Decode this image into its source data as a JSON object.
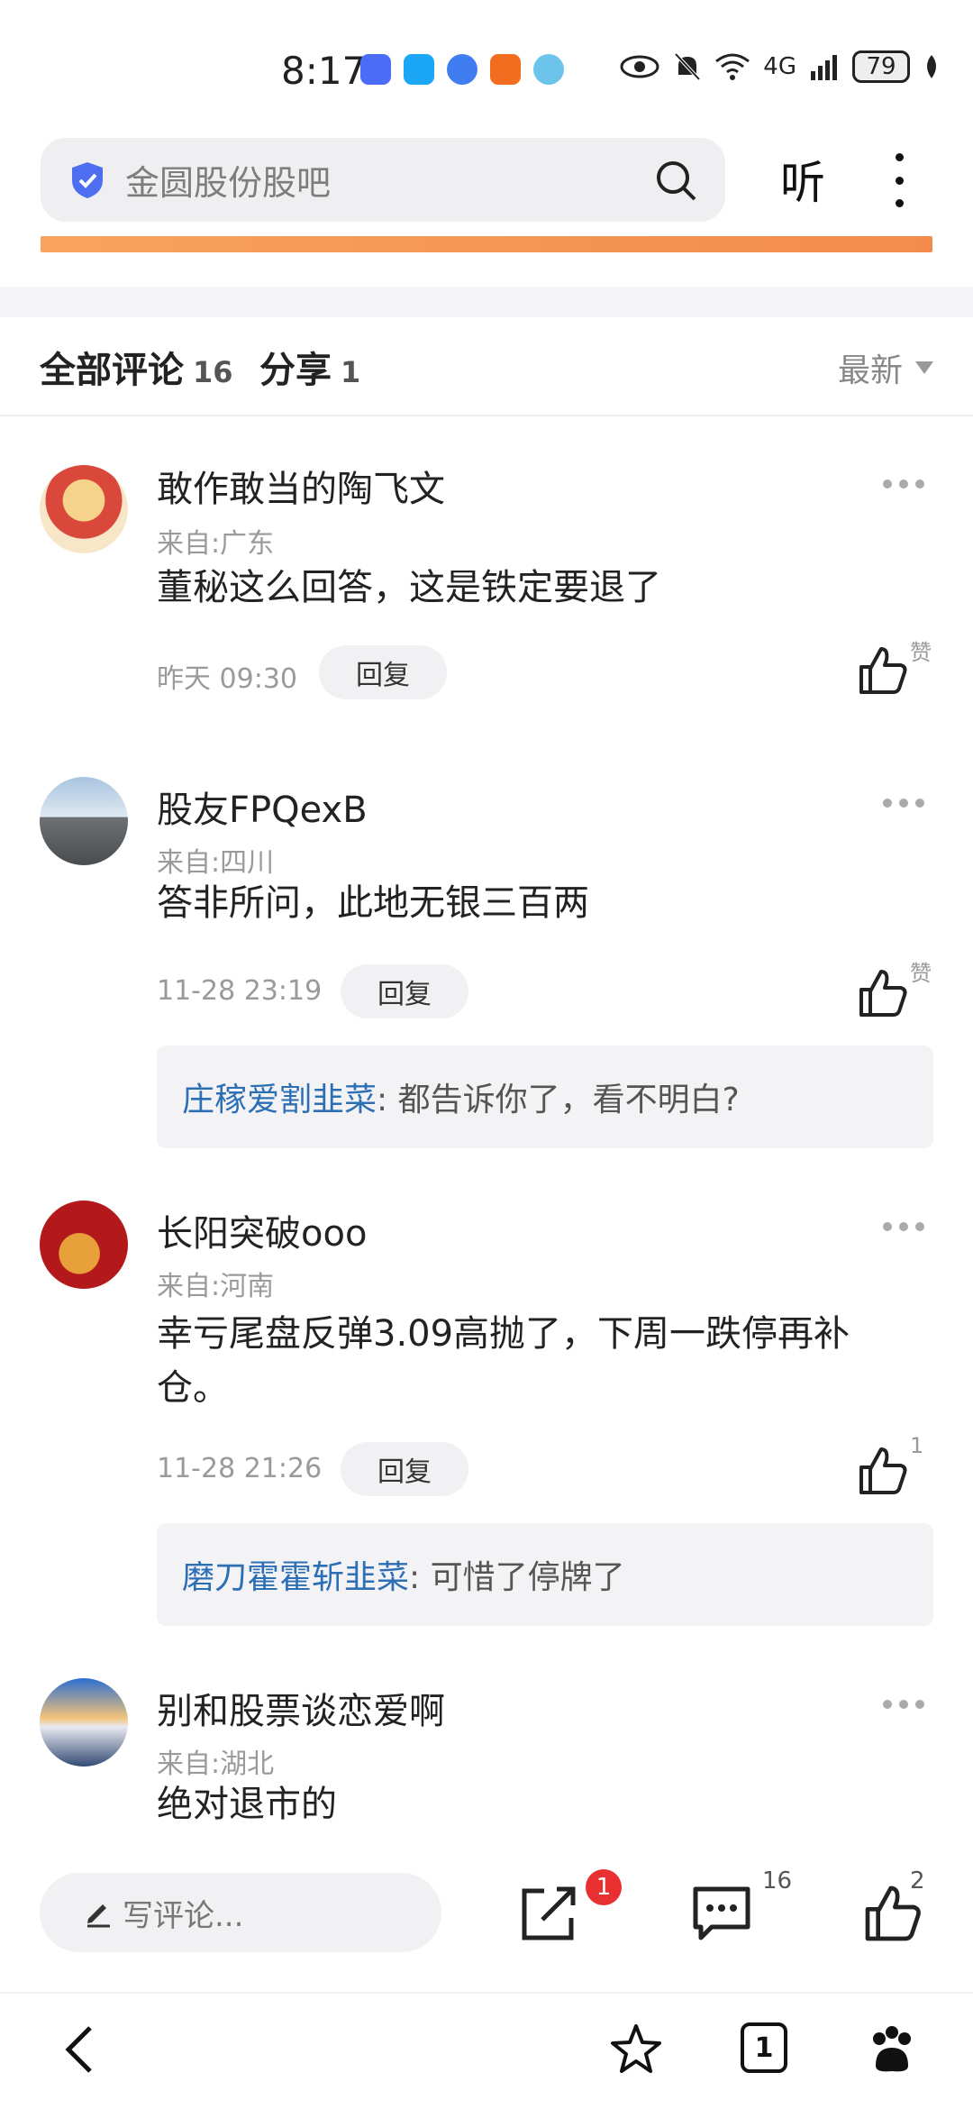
{
  "status_bar": {
    "time": "8:17",
    "network": "4G",
    "battery": "79"
  },
  "header": {
    "search_placeholder": "金圆股份股吧",
    "listen_label": "听"
  },
  "tabs": {
    "comments_label": "全部评论",
    "comments_count": "16",
    "share_label": "分享",
    "share_count": "1",
    "sort_label": "最新"
  },
  "comments": [
    {
      "user": "敢作敢当的陶飞文",
      "location": "来自:广东",
      "text": "董秘这么回答，这是铁定要退了",
      "time": "昨天 09:30",
      "reply_label": "回复",
      "like_label": "赞",
      "avatar": "god-of-wealth-avatar"
    },
    {
      "user": "股友FPQexB",
      "location": "来自:四川",
      "text": "答非所问，此地无银三百两",
      "time": "11-28 23:19",
      "reply_label": "回复",
      "like_label": "赞",
      "avatar": "landscape-avatar",
      "reply": {
        "user": "庄稼爱割韭菜",
        "text": ": 都告诉你了，看不明白?"
      }
    },
    {
      "user": "长阳突破ooo",
      "location": "来自:河南",
      "text": "幸亏尾盘反弹3.09高抛了，下周一跌停再补仓。",
      "time": "11-28 21:26",
      "reply_label": "回复",
      "like_label": "1",
      "avatar": "bull-avatar",
      "reply": {
        "user": "磨刀霍霍斩韭菜",
        "text": ": 可惜了停牌了"
      }
    },
    {
      "user": "别和股票谈恋爱啊",
      "location": "来自:湖北",
      "text": "绝对退市的",
      "avatar": "mountain-avatar"
    }
  ],
  "action_bar": {
    "write_placeholder": "写评论...",
    "share_badge": "1",
    "comment_count": "16",
    "like_count": "2"
  },
  "nav": {
    "tab_count": "1"
  }
}
